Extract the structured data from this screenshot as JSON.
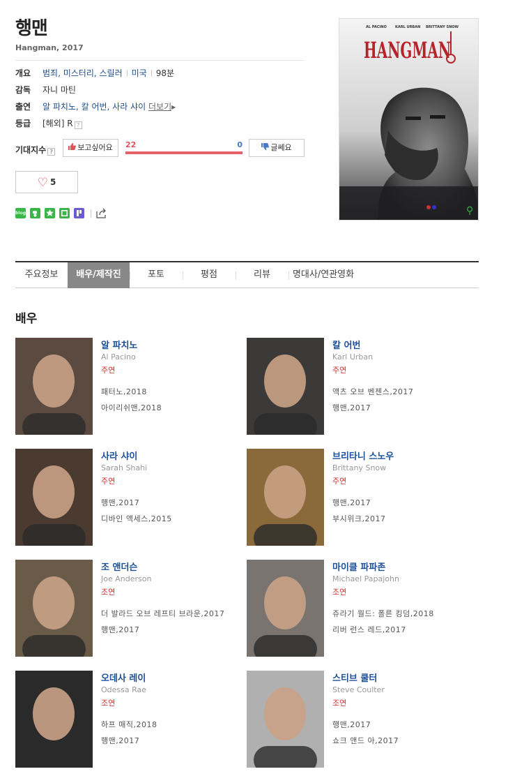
{
  "movie": {
    "title": "행맨",
    "subtitle": "Hangman, 2017"
  },
  "info": {
    "summary_label": "개요",
    "genre": "범죄, 미스터리, 스릴러",
    "country": "미국",
    "runtime": "98분",
    "director_label": "감독",
    "director": "자니 마틴",
    "cast_label": "출연",
    "cast": "알 파치노, 칼 어번, 사라 샤이",
    "more_label": "더보기",
    "rating_label": "등급",
    "rating": "[해외] R"
  },
  "expectation": {
    "label": "기대지수",
    "want_label": "보고싶어요",
    "nope_label": "글쎄요",
    "want_count": "22",
    "nope_count": "0",
    "want_ratio": 1.0
  },
  "like": {
    "count": "5"
  },
  "share": {
    "icons": [
      "blog-icon",
      "me2day-icon",
      "bookmark-star-icon",
      "line-icon",
      "post-icon",
      "share-icon"
    ],
    "blog_text": "blog"
  },
  "poster": {
    "credits": [
      "AL PACINO",
      "KARL URBAN",
      "BRITTANY SNOW"
    ],
    "title": "HANGMAN",
    "zoom_icon": "magnifier-icon"
  },
  "tabs": [
    "주요정보",
    "배우/제작진",
    "포토",
    "평점",
    "리뷰",
    "명대사/연관영화"
  ],
  "active_tab": 1,
  "section_title": "배우",
  "actors": [
    {
      "name": "알 파치노",
      "ename": "Al Pacino",
      "role": "주연",
      "works": [
        "패터노,2018",
        "아이리쉬맨,2018"
      ]
    },
    {
      "name": "칼 어번",
      "ename": "Karl Urban",
      "role": "주연",
      "works": [
        "액츠 오브 벤젠스,2017",
        "행맨,2017"
      ]
    },
    {
      "name": "사라 샤이",
      "ename": "Sarah Shahi",
      "role": "주연",
      "works": [
        "행맨,2017",
        "디바인 액세스,2015"
      ]
    },
    {
      "name": "브리타니 스노우",
      "ename": "Brittany Snow",
      "role": "주연",
      "works": [
        "행맨,2017",
        "부시위크,2017"
      ]
    },
    {
      "name": "조 앤더슨",
      "ename": "Joe Anderson",
      "role": "조연",
      "works": [
        "더 발라드 오브 레프티 브라운,2017",
        "행맨,2017"
      ]
    },
    {
      "name": "마이클 파파존",
      "ename": "Michael Papajohn",
      "role": "조연",
      "works": [
        "쥬라기 월드: 폴른 킹덤,2018",
        "리버 런스 레드,2017"
      ]
    },
    {
      "name": "오데사 레이",
      "ename": "Odessa Rae",
      "role": "조연",
      "works": [
        "하프 매직,2018",
        "행맨,2017"
      ]
    },
    {
      "name": "스티브 쿨터",
      "ename": "Steve Coulter",
      "role": "조연",
      "works": [
        "행맨,2017",
        "쇼크 앤드 아,2017"
      ]
    }
  ],
  "colors": {
    "link": "#1f4e8c",
    "actor_name": "#1a5099",
    "role": "#d0312d",
    "want_bar": "#e66068",
    "tab_active": "#888888"
  }
}
